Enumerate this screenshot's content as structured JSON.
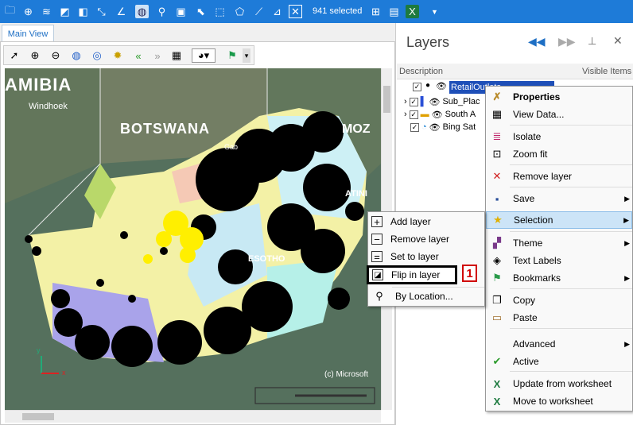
{
  "toolbar": {
    "selected_text": "941 selected"
  },
  "tab": {
    "label": "Main View"
  },
  "map": {
    "labels": [
      "AMIBIA",
      "Windhoek",
      "BOTSWANA",
      "MOZ",
      "Gab",
      "ATINI",
      "ESOTHO",
      "(c) Microsoft"
    ],
    "axes": {
      "x": "x",
      "y": "y"
    }
  },
  "layers": {
    "title": "Layers",
    "col_description": "Description",
    "col_visible": "Visible Items",
    "items": [
      {
        "name": "RetailOutlets"
      },
      {
        "name": "Sub_Plac"
      },
      {
        "name": "South A"
      },
      {
        "name": "Bing Sat"
      }
    ]
  },
  "context_menu": {
    "items": [
      {
        "label": "Properties",
        "icon": "wrench-icon"
      },
      {
        "label": "View Data...",
        "icon": "table-icon"
      },
      {
        "label": "Isolate",
        "icon": "isolate-icon"
      },
      {
        "label": "Zoom fit",
        "icon": "zoom-fit-icon"
      },
      {
        "label": "Remove layer",
        "icon": "remove-icon"
      },
      {
        "label": "Save",
        "icon": "floppy-icon"
      },
      {
        "label": "Selection",
        "icon": "star-icon"
      },
      {
        "label": "Theme",
        "icon": "theme-icon"
      },
      {
        "label": "Text Labels",
        "icon": "tag-icon"
      },
      {
        "label": "Bookmarks",
        "icon": "bookmark-icon"
      },
      {
        "label": "Copy",
        "icon": "copy-icon"
      },
      {
        "label": "Paste",
        "icon": "paste-icon"
      },
      {
        "label": "Advanced",
        "icon": ""
      },
      {
        "label": "Active",
        "icon": "check-icon"
      },
      {
        "label": "Update from worksheet",
        "icon": "excel-icon"
      },
      {
        "label": "Move to worksheet",
        "icon": "excel-icon"
      }
    ]
  },
  "submenu": {
    "items": [
      {
        "label": "Add layer",
        "icon": "plus-icon"
      },
      {
        "label": "Remove layer",
        "icon": "minus-icon"
      },
      {
        "label": "Set to layer",
        "icon": "equals-icon"
      },
      {
        "label": "Flip in layer",
        "icon": "flip-icon"
      },
      {
        "label": "By Location...",
        "icon": "location-icon"
      }
    ],
    "badge": "1"
  },
  "colors": {
    "ribbon": "#1e7bd8",
    "highlight": "#cce4f7",
    "marker_red": "#d00000"
  }
}
